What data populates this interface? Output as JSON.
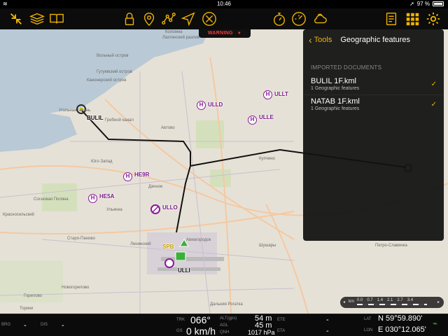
{
  "status": {
    "time": "10:46",
    "battery": "97 %"
  },
  "toolbar": {
    "left_icons": [
      "shrink-arrows-icon",
      "map-layers-icon",
      "open-book-icon"
    ],
    "mid_icons": [
      "lock-icon",
      "waypoint-pin-icon",
      "route-icon",
      "direct-to-icon",
      "cancel-route-icon"
    ],
    "center_icons": [
      "stopwatch-icon",
      "gauge-icon",
      "weather-icon"
    ],
    "right_icons": [
      "checklist-icon",
      "grid-menu-icon",
      "settings-gear-icon"
    ]
  },
  "warning": {
    "label": "WARNING"
  },
  "panel": {
    "back_label": "Tools",
    "title": "Geographic features",
    "section_label": "IMPORTED DOCUMENTS",
    "documents": [
      {
        "name": "BULIL 1F.kml",
        "subtitle": "1 Geographic features",
        "checked": true
      },
      {
        "name": "NATAB 1F.kml",
        "subtitle": "1 Geographic features",
        "checked": true
      }
    ]
  },
  "map": {
    "waypoints": [
      "BULIL",
      "ULLD",
      "ULLT",
      "ULLE",
      "HE9R",
      "HE5A",
      "ULLO",
      "ULLI",
      "SPB"
    ],
    "places": [
      "Коломна",
      "Лахтинский разлив",
      "Вольный остров",
      "Гутуевский остров",
      "Канонерский остров",
      "Угольная гавань",
      "Гребной канал",
      "Автово",
      "Юго-Запад",
      "Дачное",
      "Ульянка",
      "Сосновая Поляна",
      "Купчино",
      "Старо-Паново",
      "Авиагородок",
      "Шушары",
      "Новогорелово",
      "Горелово",
      "Торики",
      "Дальняя Рогатка",
      "Петро-Славянка",
      "Ленинский",
      "Красносельский"
    ]
  },
  "scale": {
    "unit": "km",
    "ticks": [
      "0.0",
      "0.7",
      "1.4",
      "2.1",
      "2.7",
      "3.4"
    ]
  },
  "info": {
    "brg_label": "BRG",
    "brg_value": "-",
    "dis_label": "DIS",
    "dis_value": "-",
    "trk_label": "TRK",
    "trk_value": "066°",
    "gs_label": "GS",
    "gs_value": "0 km/h",
    "alt_label": "ALT(gps)",
    "alt_value": "54 m",
    "agl_label": "AGL",
    "agl_value": "45 m",
    "qnh_label": "QNH",
    "qnh_value": "1017 hPa",
    "ete_label": "ETE",
    "ete_value": "-",
    "eta_label": "ETA",
    "eta_value": "-",
    "lat_label": "LAT",
    "lat_value": "N 59°59.890'",
    "lon_label": "LON",
    "lon_value": "E 030°12.065'"
  },
  "colors": {
    "accent": "#f0b400",
    "warning": "#ff3b3b",
    "poi": "#8a1a9a",
    "route": "#111111"
  }
}
